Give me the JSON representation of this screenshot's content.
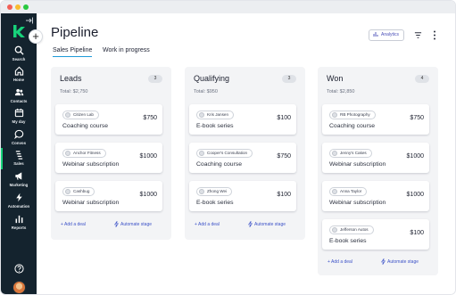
{
  "window": {
    "dots": [
      "#f25f57",
      "#f9bc2f",
      "#29c840"
    ]
  },
  "sidebar": {
    "collapse_icon": "collapse-sidebar-icon",
    "logo_icon": "app-logo-icon",
    "logo_color": "#17d27a",
    "items": [
      {
        "label": "Search",
        "icon": "search-icon"
      },
      {
        "label": "Home",
        "icon": "home-icon"
      },
      {
        "label": "Contacts",
        "icon": "contacts-icon"
      },
      {
        "label": "My day",
        "icon": "calendar-icon"
      },
      {
        "label": "Convos",
        "icon": "chat-icon"
      },
      {
        "label": "Sales",
        "icon": "sales-icon",
        "active": true
      },
      {
        "label": "Marketing",
        "icon": "megaphone-icon"
      },
      {
        "label": "Automation",
        "icon": "bolt-icon"
      },
      {
        "label": "Reports",
        "icon": "bar-chart-icon"
      }
    ],
    "help_icon": "help-icon",
    "avatar": "user-avatar"
  },
  "header": {
    "title": "Pipeline",
    "tabs": [
      {
        "label": "Sales Pipeline",
        "active": true
      },
      {
        "label": "Work in progress",
        "active": false
      }
    ],
    "analytics_label": "Analytics",
    "filter_icon": "filter-icon",
    "more_icon": "more-vertical-icon",
    "add_icon": "plus-icon",
    "accent": "#1e9bd8",
    "link_color": "#3d53c8"
  },
  "columns": [
    {
      "title": "Leads",
      "count": "3",
      "total": "Total: $2,750",
      "cards": [
        {
          "contact": "Citizen Lab",
          "deal": "Coaching course",
          "amount": "$750"
        },
        {
          "contact": "Anchor Fitness",
          "deal": "Webinar subscription",
          "amount": "$1000"
        },
        {
          "contact": "Cashbug",
          "deal": "Webinar subscription",
          "amount": "$1000"
        }
      ],
      "add_label": "+ Add a deal",
      "automate_label": "Automate stage"
    },
    {
      "title": "Qualifying",
      "count": "3",
      "total": "Total: $950",
      "cards": [
        {
          "contact": "Kris Jansen",
          "deal": "E-book series",
          "amount": "$100"
        },
        {
          "contact": "Cooper's Consultation",
          "deal": "Coaching course",
          "amount": "$750"
        },
        {
          "contact": "Zhong Wei",
          "deal": "E-book series",
          "amount": "$100"
        }
      ],
      "add_label": "+ Add a deal",
      "automate_label": "Automate stage"
    },
    {
      "title": "Won",
      "count": "4",
      "total": "Total: $2,850",
      "cards": [
        {
          "contact": "RB Photography",
          "deal": "Coaching course",
          "amount": "$750"
        },
        {
          "contact": "Jenny's Cakes",
          "deal": "Webinar subscription",
          "amount": "$1000"
        },
        {
          "contact": "Anna Taylor",
          "deal": "Webinar subscription",
          "amount": "$1000"
        },
        {
          "contact": "Jefferson Autos",
          "deal": "E-book series",
          "amount": "$100"
        }
      ],
      "add_label": "+ Add a deal",
      "automate_label": "Automate stage"
    }
  ]
}
